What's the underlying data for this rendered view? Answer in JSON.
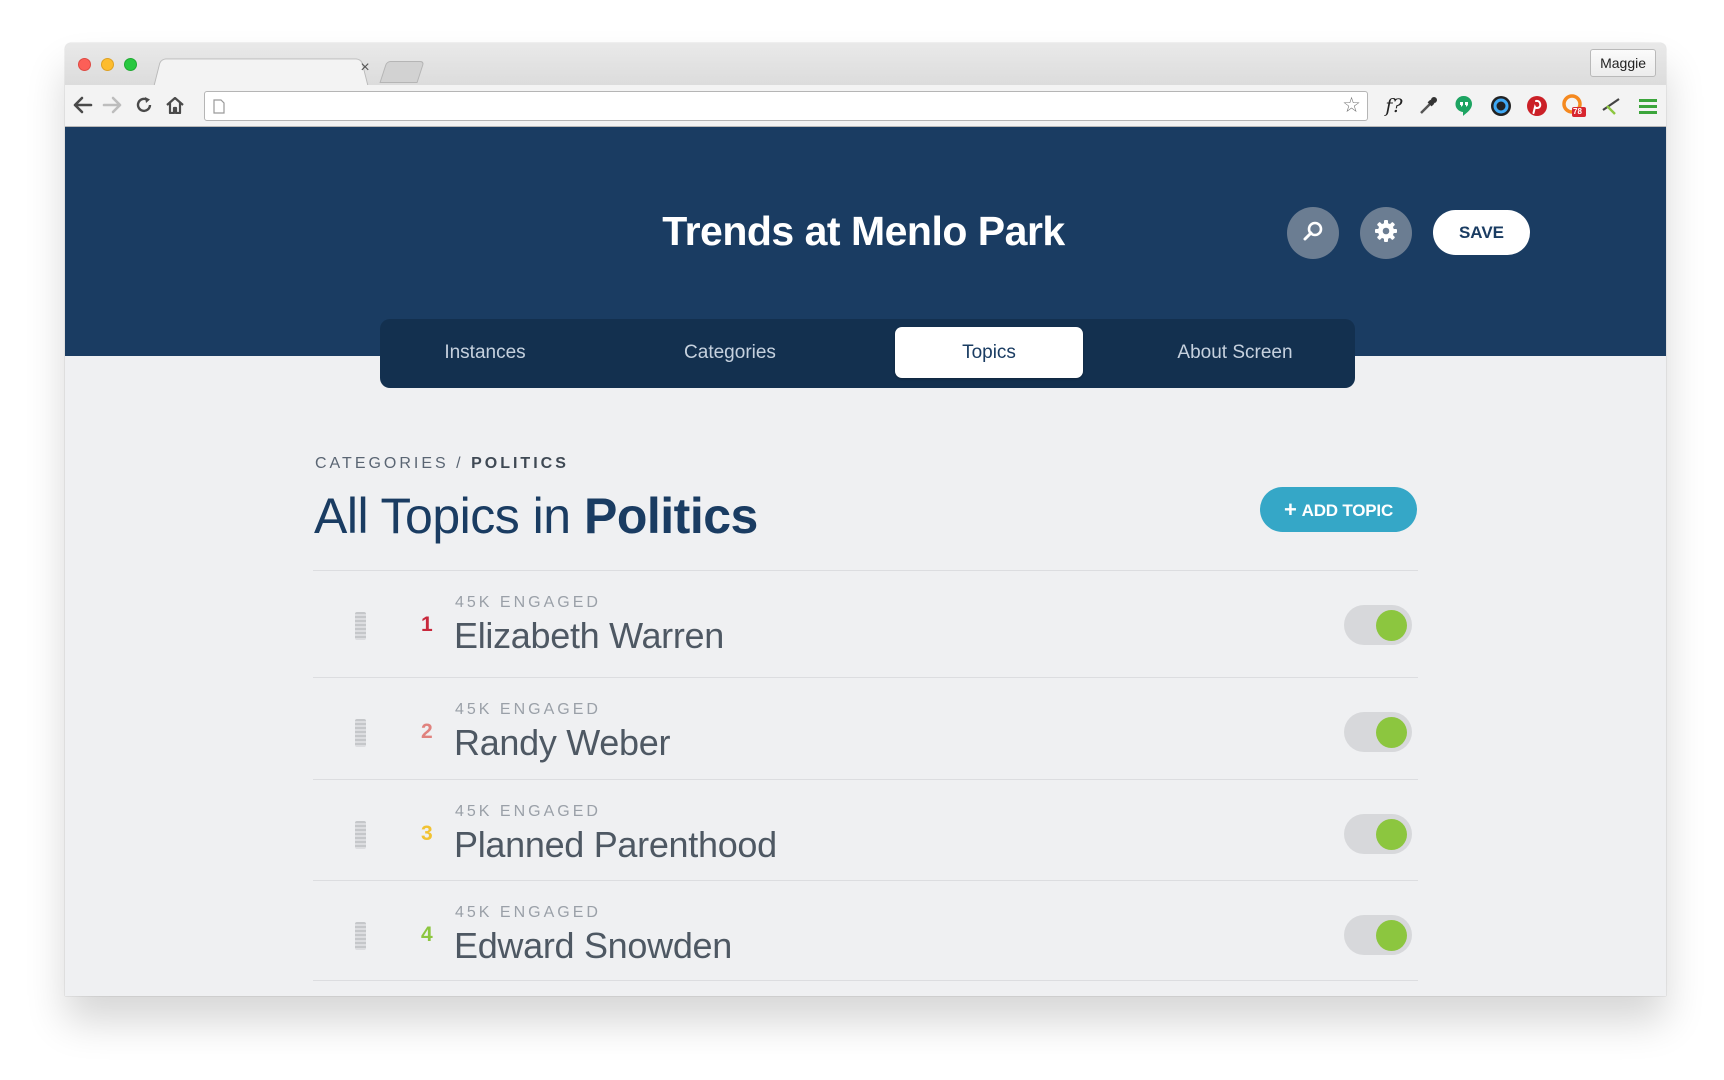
{
  "browser": {
    "profile_name": "Maggie",
    "tab_close": "×",
    "url": "",
    "extensions": [
      "font-finder-icon",
      "eyedropper-icon",
      "hangouts-icon",
      "color-wheel-icon",
      "pinterest-icon",
      "rss-badge-icon",
      "pen-tool-icon",
      "menu-icon"
    ],
    "extension_font_label": "f?",
    "badge_count": "78"
  },
  "app": {
    "title": "Trends at Menlo Park",
    "save_label": "SAVE",
    "colors": {
      "header": "#1a3c62",
      "accent": "#35a7c7",
      "toggle_on": "#8cc63f"
    }
  },
  "tabs": [
    {
      "label": "Instances",
      "active": false
    },
    {
      "label": "Categories",
      "active": false
    },
    {
      "label": "Topics",
      "active": true
    },
    {
      "label": "About Screen",
      "active": false
    }
  ],
  "breadcrumb": {
    "parent": "CATEGORIES",
    "separator": "/",
    "current": "POLITICS"
  },
  "page": {
    "title_prefix": "All Topics in",
    "title_category": "Politics",
    "add_label": "ADD TOPIC",
    "add_icon": "+"
  },
  "topics": [
    {
      "rank": "1",
      "rank_color": "#c8283c",
      "engaged": "45K ENGAGED",
      "name": "Elizabeth Warren",
      "enabled": true
    },
    {
      "rank": "2",
      "rank_color": "#e0827e",
      "engaged": "45K ENGAGED",
      "name": "Randy Weber",
      "enabled": true
    },
    {
      "rank": "3",
      "rank_color": "#f1c232",
      "engaged": "45K ENGAGED",
      "name": "Planned Parenthood",
      "enabled": true
    },
    {
      "rank": "4",
      "rank_color": "#8cc63f",
      "engaged": "45K ENGAGED",
      "name": "Edward Snowden",
      "enabled": true
    }
  ]
}
